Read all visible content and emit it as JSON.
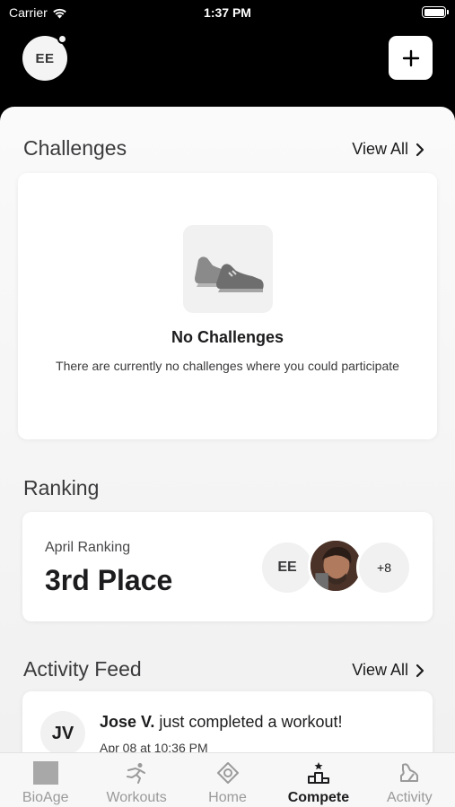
{
  "status_bar": {
    "carrier": "Carrier",
    "time": "1:37 PM"
  },
  "header": {
    "avatar_initials": "EE"
  },
  "challenges": {
    "title": "Challenges",
    "view_all": "View All",
    "empty_title": "No Challenges",
    "empty_description": "There are currently no challenges where you could participate"
  },
  "ranking": {
    "title": "Ranking",
    "label": "April Ranking",
    "value": "3rd Place",
    "participant_initials": "EE",
    "more_count": "+8"
  },
  "activity_feed": {
    "title": "Activity Feed",
    "view_all": "View All",
    "items": [
      {
        "initials": "JV",
        "name": "Jose V.",
        "action": "just completed a workout!",
        "date": "Apr 08 at 10:36 PM"
      }
    ]
  },
  "tabs": [
    {
      "label": "BioAge",
      "icon": "bioage-icon"
    },
    {
      "label": "Workouts",
      "icon": "running-figure-icon"
    },
    {
      "label": "Home",
      "icon": "home-target-icon"
    },
    {
      "label": "Compete",
      "icon": "podium-icon",
      "active": true
    },
    {
      "label": "Activity",
      "icon": "activity-icon"
    }
  ]
}
